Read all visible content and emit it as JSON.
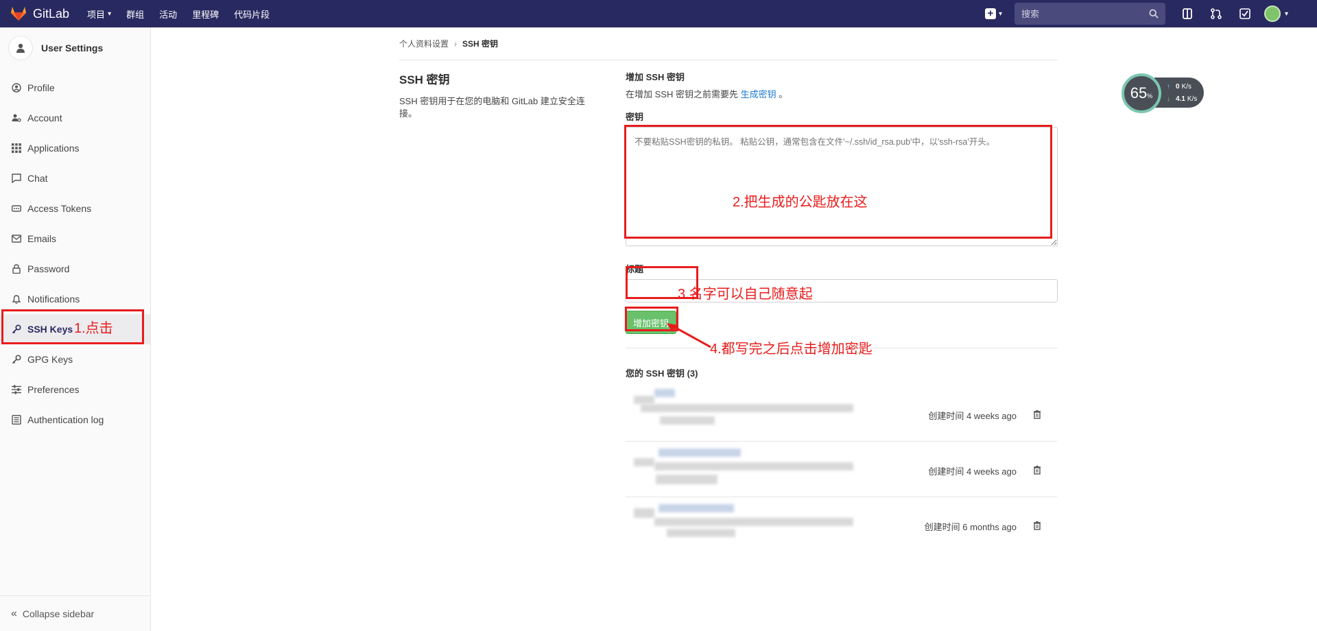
{
  "header": {
    "brand": "GitLab",
    "nav": [
      {
        "label": "项目",
        "has_dropdown": true
      },
      {
        "label": "群组"
      },
      {
        "label": "活动"
      },
      {
        "label": "里程碑"
      },
      {
        "label": "代码片段"
      }
    ],
    "search_placeholder": "搜索"
  },
  "sidebar": {
    "title": "User Settings",
    "items": [
      {
        "label": "Profile",
        "icon": "profile-icon"
      },
      {
        "label": "Account",
        "icon": "account-icon"
      },
      {
        "label": "Applications",
        "icon": "applications-icon"
      },
      {
        "label": "Chat",
        "icon": "chat-icon"
      },
      {
        "label": "Access Tokens",
        "icon": "access-tokens-icon"
      },
      {
        "label": "Emails",
        "icon": "email-icon"
      },
      {
        "label": "Password",
        "icon": "lock-icon"
      },
      {
        "label": "Notifications",
        "icon": "bell-icon"
      },
      {
        "label": "SSH Keys",
        "icon": "key-icon",
        "active": true
      },
      {
        "label": "GPG Keys",
        "icon": "key-icon"
      },
      {
        "label": "Preferences",
        "icon": "preferences-icon"
      },
      {
        "label": "Authentication log",
        "icon": "log-icon"
      }
    ],
    "collapse_label": "Collapse sidebar"
  },
  "breadcrumb": {
    "parent": "个人资料设置",
    "current": "SSH 密钥"
  },
  "section": {
    "title": "SSH 密钥",
    "description": "SSH 密钥用于在您的电脑和 GitLab 建立安全连接。"
  },
  "form": {
    "add_title": "增加 SSH 密钥",
    "hint_prefix": "在增加 SSH 密钥之前需要先",
    "hint_link": "生成密钥",
    "hint_suffix": "。",
    "key_label": "密钥",
    "key_placeholder": "不要粘贴SSH密钥的私钥。 粘贴公钥，通常包含在文件'~/.ssh/id_rsa.pub'中，以'ssh-rsa'开头。",
    "title_label": "标题",
    "title_value": "",
    "submit_label": "增加密钥"
  },
  "keys": {
    "heading": "您的 SSH 密钥 (3)",
    "items": [
      {
        "created": "创建时间 4 weeks ago"
      },
      {
        "created": "创建时间 4 weeks ago"
      },
      {
        "created": "创建时间 6 months ago"
      }
    ]
  },
  "annotations": [
    {
      "text": "1.点击"
    },
    {
      "text": "2.把生成的公匙放在这"
    },
    {
      "text": "3.名字可以自己随意起"
    },
    {
      "text": "4.都写完之后点击增加密匙"
    }
  ],
  "net_widget": {
    "percent": "65",
    "percent_unit": "%",
    "up": "0",
    "down": "4.1",
    "unit": "K/s"
  },
  "colors": {
    "header": "#292961",
    "annotation": "#e81c1c",
    "button": "#69c26b",
    "link": "#1f78d1"
  }
}
